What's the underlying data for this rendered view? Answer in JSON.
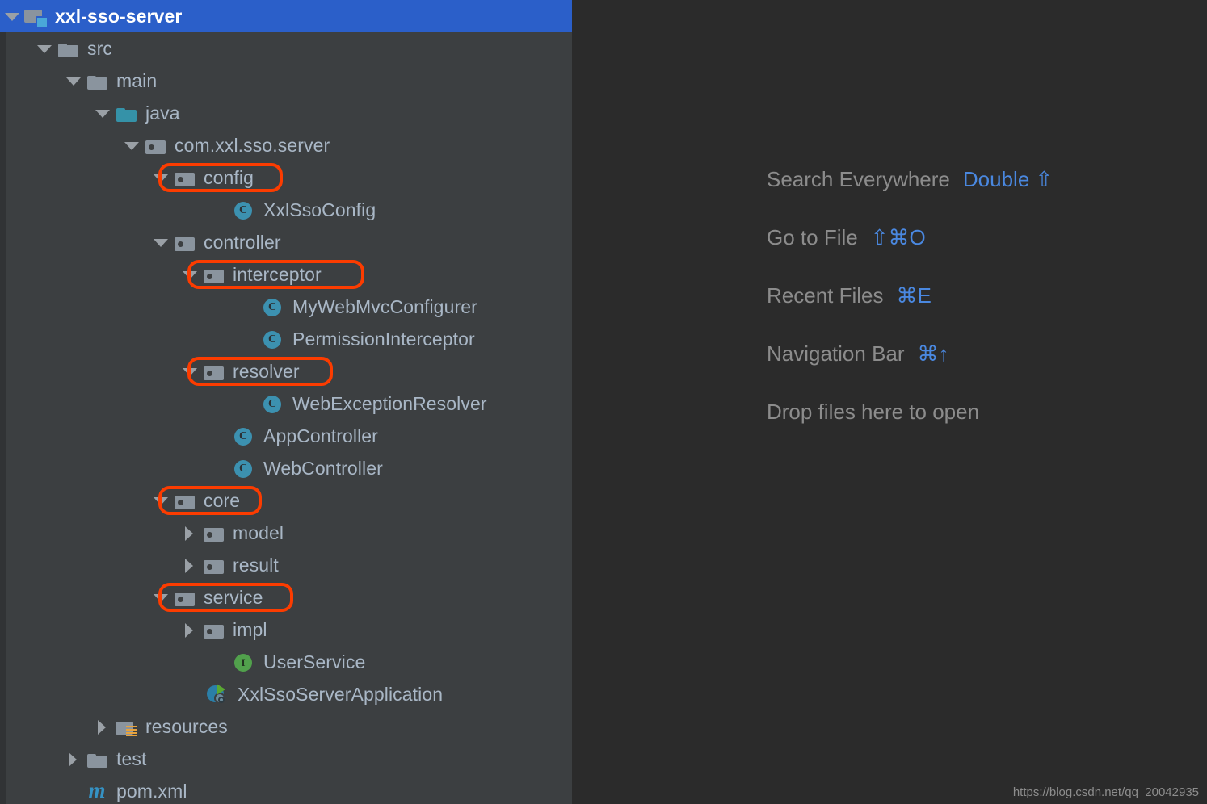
{
  "panel": {
    "name": "project-tree",
    "background": "#3c3f41",
    "selection_color": "#2b5fc9",
    "highlight_color": "#fc3c00"
  },
  "tree": {
    "rows": [
      {
        "label": "xxl-sso-server",
        "icon": "module-folder-icon",
        "twisty": "down",
        "indent": 28,
        "selected": true,
        "highlighted": false
      },
      {
        "label": "src",
        "icon": "folder-icon",
        "twisty": "down",
        "indent": 68,
        "selected": false,
        "highlighted": false
      },
      {
        "label": "main",
        "icon": "folder-icon",
        "twisty": "down",
        "indent": 104,
        "selected": false,
        "highlighted": false
      },
      {
        "label": "java",
        "icon": "source-folder-icon",
        "twisty": "down",
        "indent": 140,
        "selected": false,
        "highlighted": false
      },
      {
        "label": "com.xxl.sso.server",
        "icon": "package-icon",
        "twisty": "down",
        "indent": 176,
        "selected": false,
        "highlighted": false
      },
      {
        "label": "config",
        "icon": "package-icon",
        "twisty": "down",
        "indent": 212,
        "selected": false,
        "highlighted": true
      },
      {
        "label": "XxlSsoConfig",
        "icon": "java-class-icon",
        "twisty": "none",
        "indent": 286,
        "selected": false,
        "highlighted": false
      },
      {
        "label": "controller",
        "icon": "package-icon",
        "twisty": "down",
        "indent": 212,
        "selected": false,
        "highlighted": false
      },
      {
        "label": "interceptor",
        "icon": "package-icon",
        "twisty": "down",
        "indent": 248,
        "selected": false,
        "highlighted": true
      },
      {
        "label": "MyWebMvcConfigurer",
        "icon": "java-class-icon",
        "twisty": "none",
        "indent": 322,
        "selected": false,
        "highlighted": false
      },
      {
        "label": "PermissionInterceptor",
        "icon": "java-class-icon",
        "twisty": "none",
        "indent": 322,
        "selected": false,
        "highlighted": false
      },
      {
        "label": "resolver",
        "icon": "package-icon",
        "twisty": "down",
        "indent": 248,
        "selected": false,
        "highlighted": true
      },
      {
        "label": "WebExceptionResolver",
        "icon": "java-class-icon",
        "twisty": "none",
        "indent": 322,
        "selected": false,
        "highlighted": false
      },
      {
        "label": "AppController",
        "icon": "java-class-icon",
        "twisty": "none",
        "indent": 286,
        "selected": false,
        "highlighted": false
      },
      {
        "label": "WebController",
        "icon": "java-class-icon",
        "twisty": "none",
        "indent": 286,
        "selected": false,
        "highlighted": false
      },
      {
        "label": "core",
        "icon": "package-icon",
        "twisty": "down",
        "indent": 212,
        "selected": false,
        "highlighted": true
      },
      {
        "label": "model",
        "icon": "package-icon",
        "twisty": "right",
        "indent": 248,
        "selected": false,
        "highlighted": false
      },
      {
        "label": "result",
        "icon": "package-icon",
        "twisty": "right",
        "indent": 248,
        "selected": false,
        "highlighted": false
      },
      {
        "label": "service",
        "icon": "package-icon",
        "twisty": "down",
        "indent": 212,
        "selected": false,
        "highlighted": true
      },
      {
        "label": "impl",
        "icon": "package-icon",
        "twisty": "right",
        "indent": 248,
        "selected": false,
        "highlighted": false
      },
      {
        "label": "UserService",
        "icon": "java-interface-icon",
        "twisty": "none",
        "indent": 286,
        "selected": false,
        "highlighted": false
      },
      {
        "label": "XxlSsoServerApplication",
        "icon": "spring-boot-app-icon",
        "twisty": "none",
        "indent": 254,
        "selected": false,
        "highlighted": false
      },
      {
        "label": "resources",
        "icon": "resources-folder-icon",
        "twisty": "right",
        "indent": 140,
        "selected": false,
        "highlighted": false
      },
      {
        "label": "test",
        "icon": "folder-icon",
        "twisty": "right",
        "indent": 104,
        "selected": false,
        "highlighted": false
      },
      {
        "label": "pom.xml",
        "icon": "maven-file-icon",
        "twisty": "none",
        "indent": 104,
        "selected": false,
        "highlighted": false
      }
    ]
  },
  "editor": {
    "hints": [
      {
        "label": "Search Everywhere",
        "key": "Double ⇧"
      },
      {
        "label": "Go to File",
        "key": "⇧⌘O"
      },
      {
        "label": "Recent Files",
        "key": "⌘E"
      },
      {
        "label": "Navigation Bar",
        "key": "⌘↑"
      },
      {
        "label": "Drop files here to open",
        "key": ""
      }
    ],
    "watermark": "https://blog.csdn.net/qq_20042935"
  }
}
